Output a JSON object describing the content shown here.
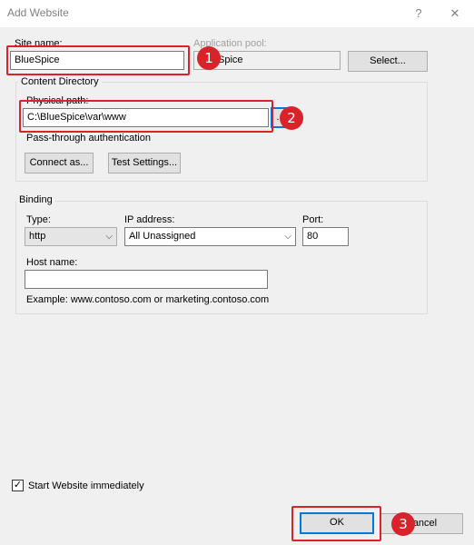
{
  "window": {
    "title": "Add Website",
    "help_icon": "?",
    "close_icon": "✕"
  },
  "site": {
    "name_label": "Site name:",
    "name_value": "BlueSpice",
    "pool_label": "Application pool:",
    "pool_value": "BlueSpice",
    "select_button": "Select..."
  },
  "content": {
    "group_label": "Content Directory",
    "path_label": "Physical path:",
    "path_value": "C:\\BlueSpice\\var\\www",
    "browse_button": "...",
    "passthrough_label": "Pass-through authentication",
    "connect_button": "Connect as...",
    "test_button": "Test Settings..."
  },
  "binding": {
    "group_label": "Binding",
    "type_label": "Type:",
    "type_value": "http",
    "ip_label": "IP address:",
    "ip_value": "All Unassigned",
    "port_label": "Port:",
    "port_value": "80",
    "host_label": "Host name:",
    "host_value": "",
    "example_text": "Example: www.contoso.com or marketing.contoso.com"
  },
  "start": {
    "label": "Start Website immediately",
    "checked": true
  },
  "footer": {
    "ok_button": "OK",
    "cancel_button": "Cancel"
  },
  "annotations": {
    "step1": "1",
    "step2": "2",
    "step3": "3",
    "color": "#d9232a"
  }
}
